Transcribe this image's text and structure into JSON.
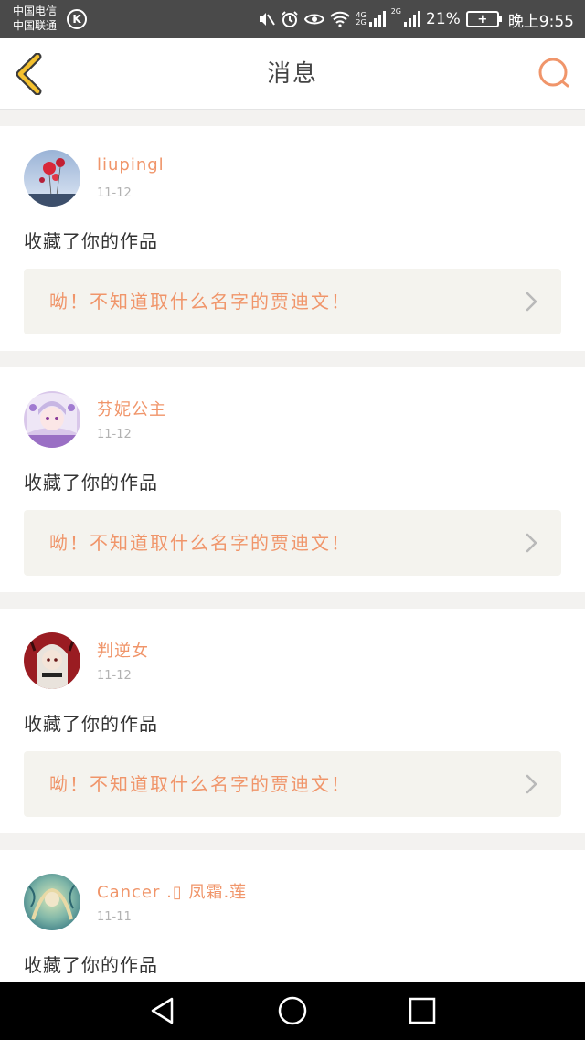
{
  "status_bar": {
    "carrier_1": "中国电信",
    "carrier_2": "中国联通",
    "k_badge": "K",
    "net_1": "4G",
    "net_2": "2G",
    "net_3": "2G",
    "battery_percent": "21%",
    "time": "晚上9:55",
    "icons": [
      "mute-icon",
      "alarm-icon",
      "eye-icon",
      "wifi-icon",
      "signal-icon",
      "battery-icon"
    ]
  },
  "header": {
    "title": "消息",
    "back_icon": "back-chevron-icon",
    "search_icon": "search-icon"
  },
  "messages": [
    {
      "name": "liupingl",
      "date": "11-12",
      "action": "收藏了你的作品",
      "work_title": "呦！不知道取什么名字的贾迪文！",
      "avatar": "avatar-balloons"
    },
    {
      "name": "芬妮公主",
      "date": "11-12",
      "action": "收藏了你的作品",
      "work_title": "呦！不知道取什么名字的贾迪文！",
      "avatar": "avatar-anime-purple"
    },
    {
      "name": "判逆女",
      "date": "11-12",
      "action": "收藏了你的作品",
      "work_title": "呦！不知道取什么名字的贾迪文！",
      "avatar": "avatar-anime-red"
    },
    {
      "name": "Cancer .▯ 凤霜.莲",
      "date": "11-11",
      "action": "收藏了你的作品",
      "work_title": "",
      "avatar": "avatar-anime-teal"
    }
  ],
  "colors": {
    "accent": "#f0956a",
    "status_bar": "#4a4a4a",
    "nav_bar": "#000000",
    "page_bg": "#f3f2f0",
    "work_bg": "#f4f3ee"
  },
  "nav_bar": {
    "icons": [
      "nav-back-icon",
      "nav-home-icon",
      "nav-recents-icon"
    ]
  }
}
